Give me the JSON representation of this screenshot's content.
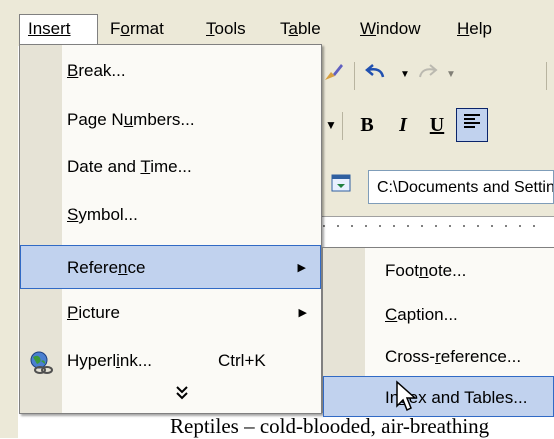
{
  "menubar": {
    "items": [
      {
        "text": "Insert",
        "mnemonic_index": 0
      },
      {
        "text": "Format",
        "mnemonic_index": 1
      },
      {
        "text": "Tools",
        "mnemonic_index": 0
      },
      {
        "text": "Table",
        "mnemonic_index": 1
      },
      {
        "text": "Window",
        "mnemonic_index": 0
      },
      {
        "text": "Help",
        "mnemonic_index": 0
      }
    ]
  },
  "insert_menu": {
    "items": [
      {
        "pre": "",
        "u": "B",
        "post": "reak..."
      },
      {
        "pre": "Page N",
        "u": "u",
        "post": "mbers..."
      },
      {
        "pre": "Date and ",
        "u": "T",
        "post": "ime..."
      },
      {
        "pre": "",
        "u": "S",
        "post": "ymbol..."
      },
      {
        "pre": "Refere",
        "u": "n",
        "post": "ce"
      },
      {
        "pre": "",
        "u": "P",
        "post": "icture"
      },
      {
        "pre": "Hyperl",
        "u": "i",
        "post": "nk...",
        "shortcut": "Ctrl+K"
      }
    ],
    "more_glyph": "»"
  },
  "reference_menu": {
    "items": [
      {
        "pre": "Foot",
        "u": "n",
        "post": "ote..."
      },
      {
        "pre": "",
        "u": "C",
        "post": "aption..."
      },
      {
        "pre": "Cross-",
        "u": "r",
        "post": "eference..."
      },
      {
        "pre": "In",
        "u": "d",
        "post": "ex and Tables..."
      }
    ]
  },
  "toolbar": {
    "bold": "B",
    "italic": "I",
    "underline": "U",
    "address_value": "C:\\Documents and Settings"
  },
  "document": {
    "visible_text": "Reptiles – cold-blooded, air-breathing"
  },
  "colors": {
    "menu_bg": "#ece9d8",
    "highlight": "#c1d2ee",
    "highlight_border": "#316ac5"
  },
  "icons": {
    "hyperlink": "globe-chain-icon",
    "submenu_arrow": "triangle-right-icon",
    "more": "double-chevron-down-icon"
  }
}
